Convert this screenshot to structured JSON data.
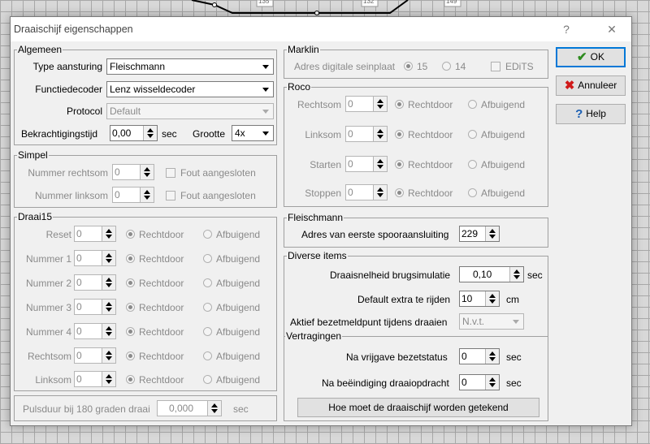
{
  "background": {
    "track_labels": [
      "135",
      "132",
      "149"
    ]
  },
  "window": {
    "title": "Draaischijf eigenschappen",
    "help_symbol": "?",
    "close_symbol": "✕"
  },
  "buttons": {
    "ok": "OK",
    "cancel": "Annuleer",
    "help": "Help"
  },
  "icons": {
    "ok": "checkmark-icon",
    "cancel": "cross-icon",
    "help": "question-icon"
  },
  "colors": {
    "ok_icon": "#2e8b1f",
    "cancel_icon": "#d01a1a",
    "help_icon": "#1a5fb4",
    "focus_border": "#0078d7"
  },
  "algemeen": {
    "legend": "Algemeen",
    "type_label": "Type aansturing",
    "type_value": "Fleischmann",
    "decoder_label": "Functiedecoder",
    "decoder_value": "Lenz wisseldecoder",
    "protocol_label": "Protocol",
    "protocol_value": "Default",
    "bekrachtiging_label": "Bekrachtigingstijd",
    "bekrachtiging_value": "0,00",
    "bekrachtiging_unit": "sec",
    "grootte_label": "Grootte",
    "grootte_value": "4x"
  },
  "simpel": {
    "legend": "Simpel",
    "rows": [
      {
        "label": "Nummer rechtsom",
        "value": "0",
        "check": "Fout aangesloten"
      },
      {
        "label": "Nummer linksom",
        "value": "0",
        "check": "Fout aangesloten"
      }
    ]
  },
  "draai15": {
    "legend": "Draai15",
    "radio_a": "Rechtdoor",
    "radio_b": "Afbuigend",
    "rows": [
      {
        "label": "Reset",
        "value": "0"
      },
      {
        "label": "Nummer 1",
        "value": "0"
      },
      {
        "label": "Nummer 2",
        "value": "0"
      },
      {
        "label": "Nummer 3",
        "value": "0"
      },
      {
        "label": "Nummer 4",
        "value": "0"
      },
      {
        "label": "Rechtsom",
        "value": "0"
      },
      {
        "label": "Linksom",
        "value": "0"
      }
    ]
  },
  "puls": {
    "label": "Pulsduur bij 180 graden draai",
    "value": "0,000",
    "unit": "sec"
  },
  "marklin": {
    "legend": "Marklin",
    "label": "Adres digitale seinplaat",
    "opt15": "15",
    "opt14": "14",
    "edits": "EDiTS"
  },
  "roco": {
    "legend": "Roco",
    "radio_a": "Rechtdoor",
    "radio_b": "Afbuigend",
    "rows": [
      {
        "label": "Rechtsom",
        "value": "0"
      },
      {
        "label": "Linksom",
        "value": "0"
      },
      {
        "label": "Starten",
        "value": "0"
      },
      {
        "label": "Stoppen",
        "value": "0"
      }
    ]
  },
  "fleischmann": {
    "legend": "Fleischmann",
    "label": "Adres van eerste spooraansluiting",
    "value": "229"
  },
  "diverse": {
    "legend": "Diverse items",
    "snelheid_label": "Draaisnelheid brugsimulatie",
    "snelheid_value": "0,10",
    "snelheid_unit": "sec",
    "extra_label": "Default extra te rijden",
    "extra_value": "10",
    "extra_unit": "cm",
    "aktief_label": "Aktief bezetmeldpunt tijdens draaien",
    "aktief_value": "N.v.t."
  },
  "vertragingen": {
    "legend": "Vertragingen",
    "vrijgave_label": "Na vrijgave bezetstatus",
    "vrijgave_value": "0",
    "vrijgave_unit": "sec",
    "beeindiging_label": "Na beëindiging draaiopdracht",
    "beeindiging_value": "0",
    "beeindiging_unit": "sec",
    "button": "Hoe moet de draaischijf worden getekend"
  }
}
